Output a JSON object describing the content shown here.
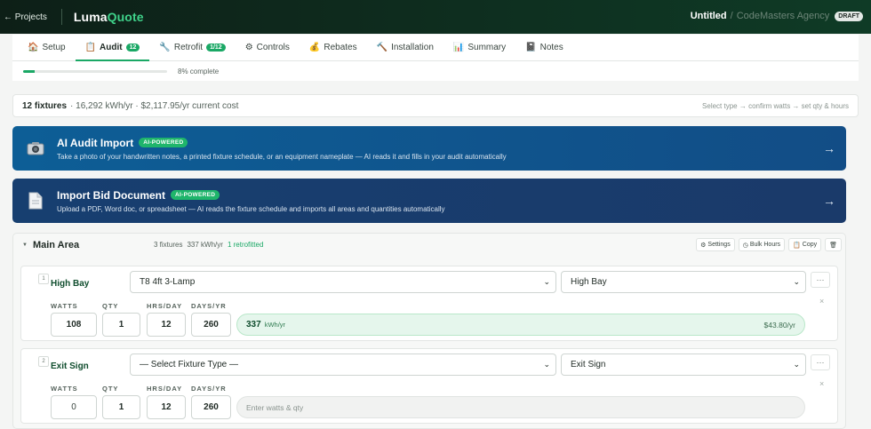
{
  "topbar": {
    "back_label": "← Projects",
    "brand_a": "Luma",
    "brand_b": "Quote",
    "project_title": "Untitled",
    "separator": "/",
    "agency": "CodeMasters Agency",
    "status_badge": "DRAFT"
  },
  "tabs": [
    {
      "label": "Setup",
      "icon": "house-icon",
      "glyph": "🏠"
    },
    {
      "label": "Audit",
      "icon": "clipboard-icon",
      "glyph": "📋",
      "badge": "12",
      "active": true
    },
    {
      "label": "Retrofit",
      "icon": "wrench-icon",
      "glyph": "🔧",
      "badge": "1/12"
    },
    {
      "label": "Controls",
      "icon": "gear-icon",
      "glyph": "⚙"
    },
    {
      "label": "Rebates",
      "icon": "moneybag-icon",
      "glyph": "💰"
    },
    {
      "label": "Installation",
      "icon": "hammer-icon",
      "glyph": "🔨"
    },
    {
      "label": "Summary",
      "icon": "chart-icon",
      "glyph": "📊"
    },
    {
      "label": "Notes",
      "icon": "notebook-icon",
      "glyph": "📓"
    }
  ],
  "progress": {
    "percent": 8,
    "label": "8% complete"
  },
  "summary": {
    "count": "12 fixtures",
    "details": "· 16,292 kWh/yr · $2,117.95/yr current cost",
    "hint": "Select type → confirm watts → set qty & hours"
  },
  "banners": {
    "ai_import": {
      "icon": "camera-icon",
      "title": "AI Audit Import",
      "badge": "AI-POWERED",
      "description": "Take a photo of your handwritten notes, a printed fixture schedule, or an equipment nameplate — AI reads it and fills in your audit automatically",
      "arrow": "→"
    },
    "bid_import": {
      "icon": "document-icon",
      "title": "Import Bid Document",
      "badge": "AI-POWERED",
      "description": "Upload a PDF, Word doc, or spreadsheet — AI reads the fixture schedule and imports all areas and quantities automatically",
      "arrow": "→"
    }
  },
  "area": {
    "name": "Main Area",
    "fixtures": "3 fixtures",
    "kwh": "337 kWh/yr",
    "retrofitted": "1 retrofitted",
    "actions": {
      "settings": "Settings",
      "bulk_hours": "Bulk Hours",
      "copy": "Copy",
      "delete_icon": "trash-icon"
    }
  },
  "field_labels": {
    "watts": "WATTS",
    "qty": "QTY",
    "hrs": "HRS/DAY",
    "days": "DAYS/YR"
  },
  "fixtures": [
    {
      "index": "1",
      "name": "High Bay",
      "type": "T8 4ft 3-Lamp",
      "category": "High Bay",
      "watts": "108",
      "qty": "1",
      "hrs": "12",
      "days": "260",
      "kwh": "337",
      "kwh_unit": "kWh/yr",
      "cost": "$43.80/yr",
      "more": "···",
      "remove": "×"
    },
    {
      "index": "2",
      "name": "Exit Sign",
      "type": "— Select Fixture Type —",
      "category": "Exit Sign",
      "watts": "0",
      "qty": "1",
      "hrs": "12",
      "days": "260",
      "placeholder": "Enter watts & qty",
      "more": "···",
      "remove": "×"
    }
  ]
}
